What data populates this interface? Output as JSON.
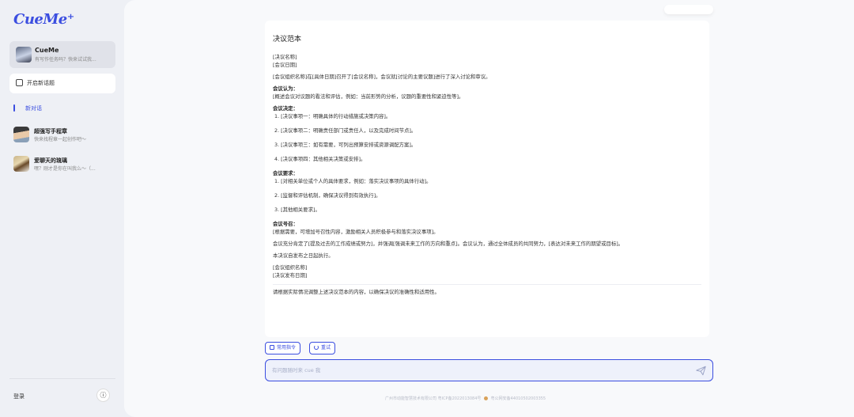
{
  "brand": {
    "logo": "CueMe⁺",
    "accent": "#3b4ee0"
  },
  "sidebar": {
    "agent": {
      "name": "CueMe",
      "desc": "有写作任务吗？快来试试我..."
    },
    "new_topic": "开启新话题",
    "active_conversation": "新对话",
    "conversations": [
      {
        "title": "超强写手程章",
        "desc": "快来找程章一起创作吧～"
      },
      {
        "title": "爱聊天的琉璃",
        "desc": "嘿？刚才是你在叫我么～（..."
      }
    ],
    "login": "登录",
    "info_icon": "ⓘ"
  },
  "content": {
    "title": "决议范本",
    "lines": [
      {
        "text": "[决议名称]",
        "bold": false
      },
      {
        "text": "[会议日期]",
        "bold": false
      },
      {
        "text": "[会议组织名称]在[具体日期]召开了[会议名称]，会议就[讨论的主要议题]进行了深入讨论和审议。",
        "bold": false,
        "gap": true
      },
      {
        "text": "会议认为：",
        "bold": true,
        "gap": true
      },
      {
        "text": "[概述会议对议题的看法和评估，例如：当前形势的分析，议题的重要性和紧迫性等]。",
        "bold": false
      },
      {
        "text": "会议决定：",
        "bold": true,
        "gap": true
      },
      {
        "text": "1. [决议事项一：明确具体的行动措施或决策内容]。",
        "li": true
      },
      {
        "text": "2. [决议事项二：明确责任部门或责任人，以及完成时间节点]。",
        "li": true
      },
      {
        "text": "3. [决议事项三：如有需要，可列出预算安排或资源调配方案]。",
        "li": true
      },
      {
        "text": "4. [决议事项四：其他相关决策或安排]。",
        "li": true
      },
      {
        "text": "会议要求：",
        "bold": true
      },
      {
        "text": "1. [对相关单位或个人的具体要求，例如：落实决议事项的具体行动]。",
        "li": true
      },
      {
        "text": "2. [监督和评估机制，确保决议得到有效执行]。",
        "li": true
      },
      {
        "text": "3. [其他相关要求]。",
        "li": true
      },
      {
        "text": "会议号召：",
        "bold": true
      },
      {
        "text": "[根据需要，可增加号召性内容，激励相关人员积极参与和落实决议事项]。",
        "bold": false
      },
      {
        "text": "会议充分肯定了[提及过去的工作成绩或努力]，并强调[强调未来工作的方向和重点]。会议认为，通过全体成员的共同努力，[表达对未来工作的期望或目标]。",
        "bold": false,
        "gap": true
      },
      {
        "text": "本决议自发布之日起执行。",
        "bold": false,
        "gap": true
      },
      {
        "text": "[会议组织名称]",
        "bold": false,
        "gap": true
      },
      {
        "text": "[决议发布日期]",
        "bold": false
      }
    ],
    "note": "请根据实际情况调整上述决议范本的内容，以确保决议的准确性和适用性。"
  },
  "actions": {
    "common_commands": "常用指令",
    "retry": "重试"
  },
  "input": {
    "placeholder": "有问题随时来 cue 我"
  },
  "footer": {
    "icp": "广州市动能智慧技术有限公司 粤ICP备2022013084号",
    "police": "粤公网安备44010502003355"
  }
}
